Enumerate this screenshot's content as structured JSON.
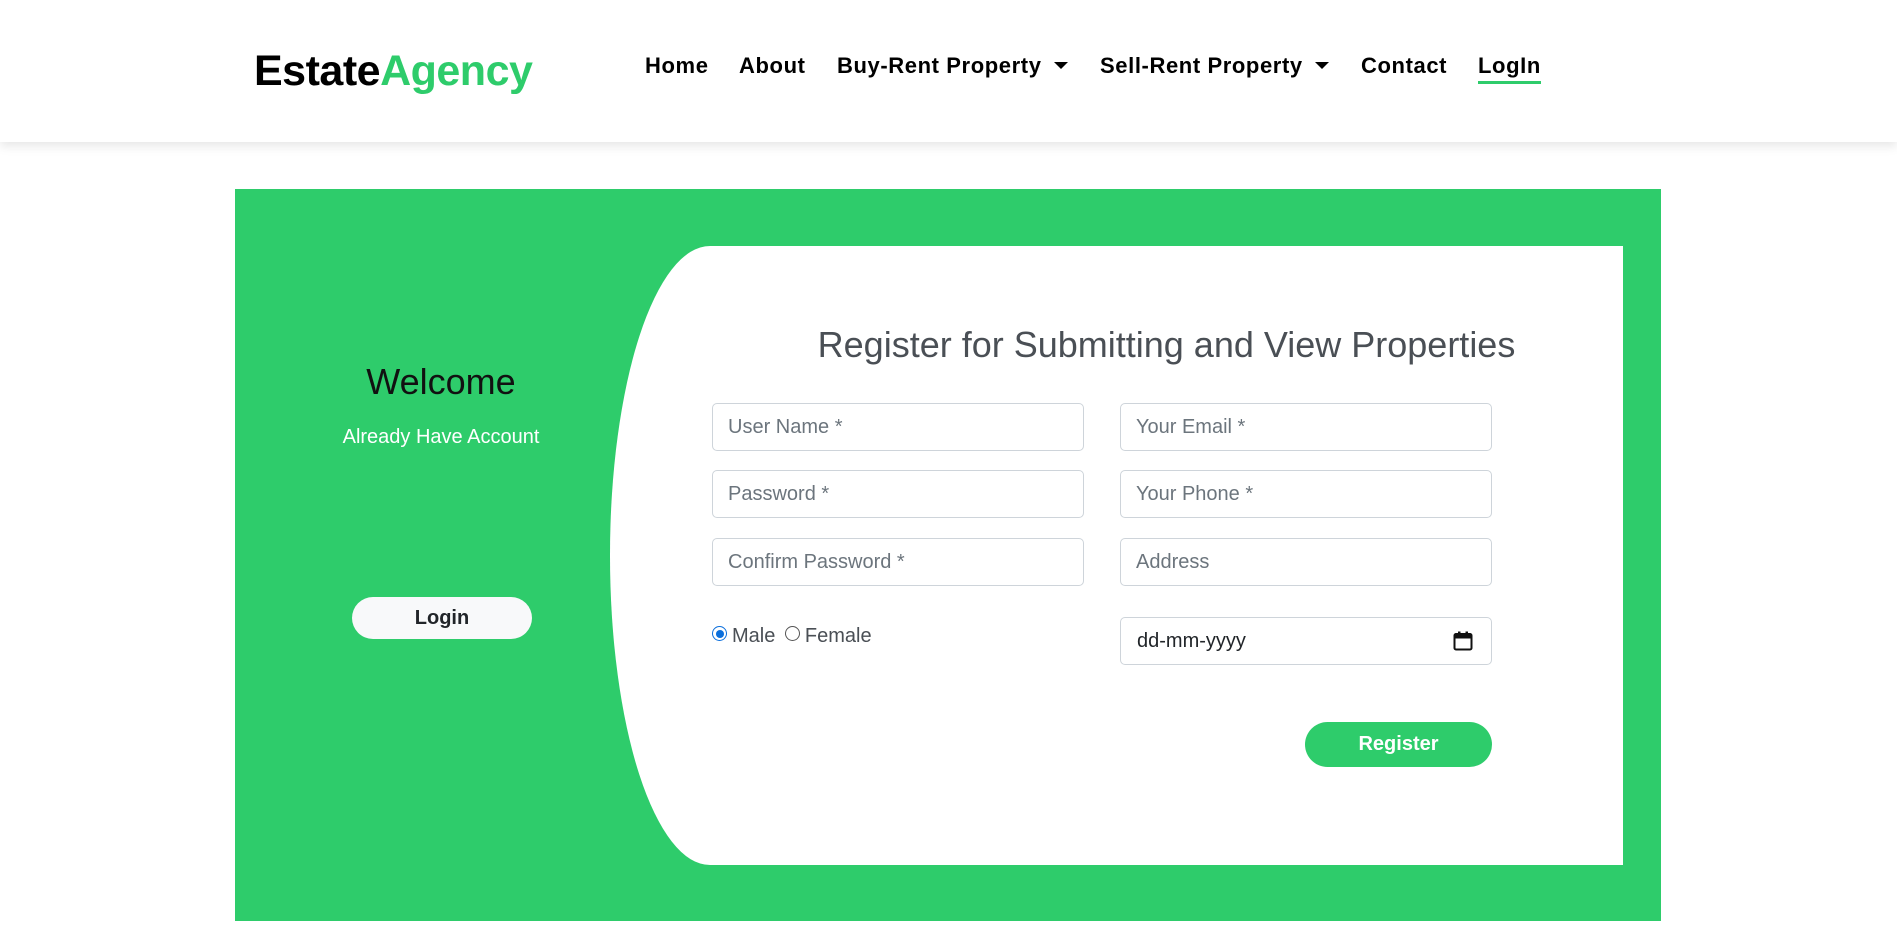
{
  "brand": {
    "part1": "Estate",
    "part2": "Agency"
  },
  "nav": {
    "home": "Home",
    "about": "About",
    "buy_rent": "Buy-Rent Property",
    "sell_rent": "Sell-Rent Property",
    "contact": "Contact",
    "login": "LogIn"
  },
  "welcome": {
    "title": "Welcome",
    "subtitle": "Already Have Account",
    "login_button": "Login"
  },
  "form": {
    "title": "Register for Submitting and View Properties",
    "username_placeholder": "User Name *",
    "email_placeholder": "Your Email *",
    "password_placeholder": "Password *",
    "phone_placeholder": "Your Phone *",
    "confirm_password_placeholder": "Confirm Password *",
    "address_placeholder": "Address",
    "gender_male": "Male",
    "gender_female": "Female",
    "gender_selected": "Male",
    "date_placeholder": "dd-mm-yyyy",
    "register_button": "Register"
  },
  "colors": {
    "accent": "#2ecc6b",
    "text_dark": "#000000",
    "radio_checked": "#0b6fdc"
  },
  "icons": {
    "date": "calendar-icon",
    "dropdown": "caret-down-icon"
  }
}
